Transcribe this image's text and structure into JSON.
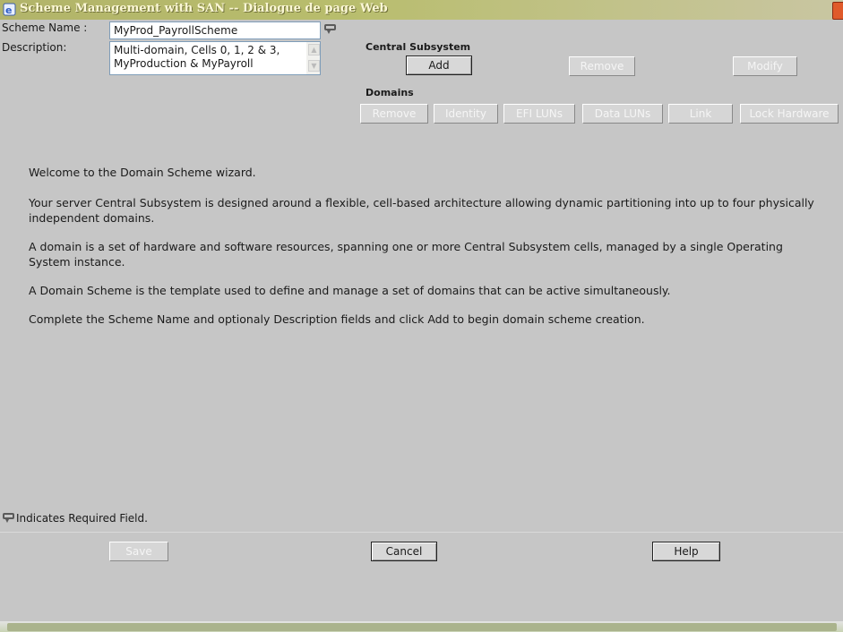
{
  "window": {
    "title": "Scheme Management with SAN -- Dialogue de page Web",
    "close_icon": "close-icon"
  },
  "form": {
    "scheme_name_label": "Scheme Name :",
    "scheme_name_value": "MyProd_PayrollScheme",
    "description_label": "Description:",
    "description_value": "Multi-domain, Cells 0, 1, 2 & 3, MyProduction & MyPayroll",
    "required_icon": "required-marker-icon"
  },
  "central_subsystem": {
    "heading": "Central Subsystem",
    "add": "Add",
    "remove": "Remove",
    "modify": "Modify"
  },
  "domains": {
    "heading": "Domains",
    "remove": "Remove",
    "identity": "Identity",
    "efi_luns": "EFI LUNs",
    "data_luns": "Data LUNs",
    "link": "Link",
    "lock_hardware": "Lock Hardware"
  },
  "content": {
    "p1": "Welcome to the Domain Scheme wizard.",
    "p2": "Your server Central Subsystem is designed around a flexible, cell-based architecture allowing dynamic partitioning into up to four physically independent domains.",
    "p3": "A domain is a set of hardware and software resources, spanning one or more Central Subsystem cells, managed by a single Operating System instance.",
    "p4": "A Domain Scheme is the template used to define and manage a set of domains that can be active simultaneously.",
    "p5": "Complete the Scheme Name and optionaly Description fields and click Add to begin domain scheme creation."
  },
  "footer": {
    "required_note": "Indicates Required Field.",
    "save": "Save",
    "cancel": "Cancel",
    "help": "Help"
  }
}
